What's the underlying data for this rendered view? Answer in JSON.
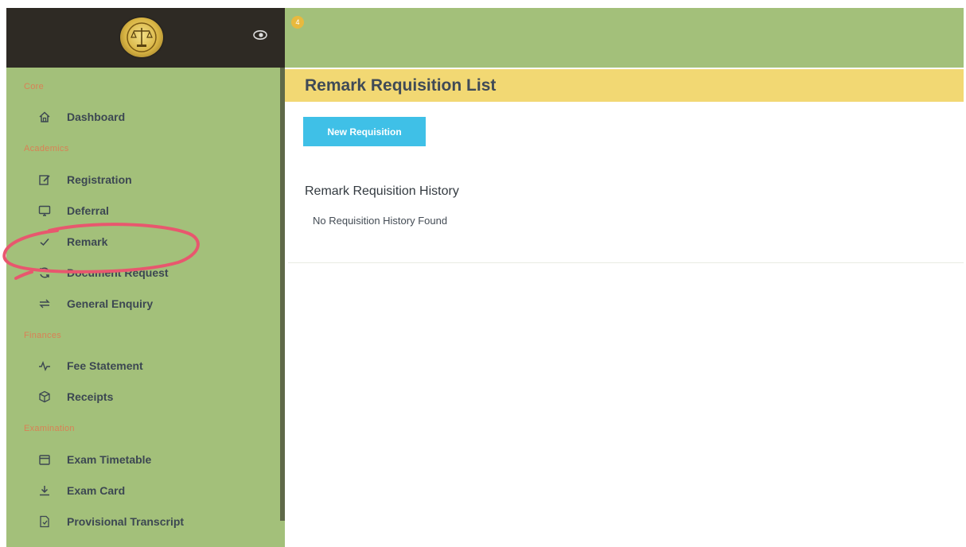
{
  "sidebar": {
    "sections": {
      "core": "Core",
      "academics": "Academics",
      "finances": "Finances",
      "examination": "Examination"
    },
    "items": [
      {
        "label": "Dashboard",
        "icon": "home-icon"
      },
      {
        "label": "Registration",
        "icon": "edit-icon"
      },
      {
        "label": "Deferral",
        "icon": "monitor-icon"
      },
      {
        "label": "Remark",
        "icon": "check-icon"
      },
      {
        "label": "Document Request",
        "icon": "refresh-icon"
      },
      {
        "label": "General Enquiry",
        "icon": "swap-icon"
      },
      {
        "label": "Fee Statement",
        "icon": "pulse-icon"
      },
      {
        "label": "Receipts",
        "icon": "box-icon"
      },
      {
        "label": "Exam Timetable",
        "icon": "calendar-icon"
      },
      {
        "label": "Exam Card",
        "icon": "download-icon"
      },
      {
        "label": "Provisional Transcript",
        "icon": "file-icon"
      }
    ]
  },
  "topbar": {
    "badge": "4"
  },
  "main": {
    "title": "Remark Requisition List",
    "new_button_label": "New Requisition",
    "history_title": "Remark Requisition History",
    "empty_message": "No Requisition History Found"
  },
  "colors": {
    "sidebar_bg": "#a3c07a",
    "sidebar_header_bg": "#2e2a24",
    "title_band_bg": "#f2d873",
    "button_bg": "#3fc0e7",
    "section_label": "#e3764f",
    "annotation": "#e8576e"
  }
}
